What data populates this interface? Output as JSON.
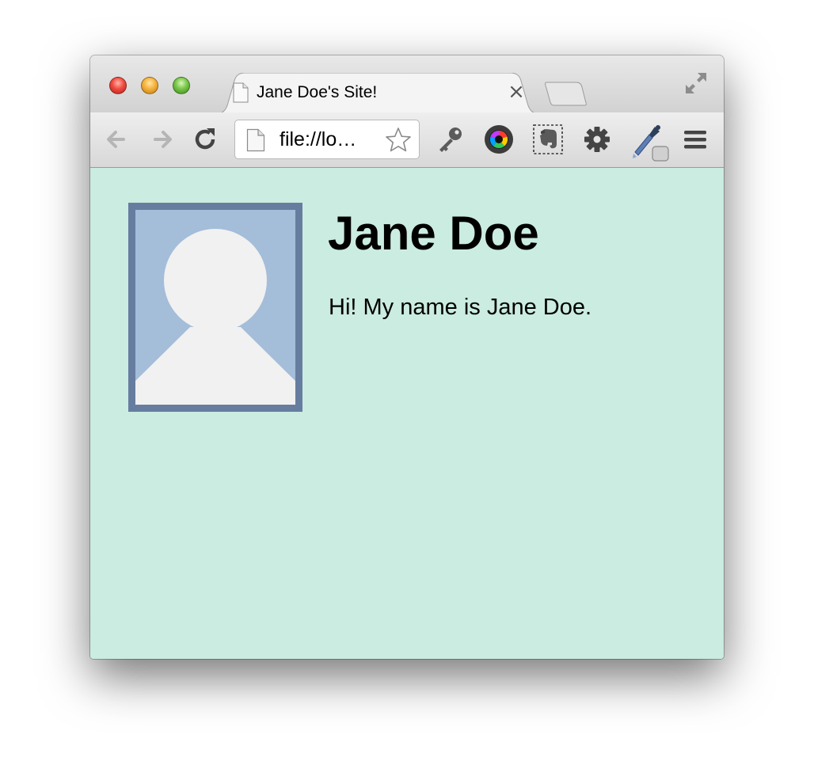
{
  "browser": {
    "tab": {
      "title": "Jane Doe's Site!",
      "close_glyph": "×",
      "favicon": "page-icon"
    },
    "toolbar": {
      "back_icon": "arrow-left-icon",
      "forward_icon": "arrow-right-icon",
      "reload_icon": "reload-icon",
      "address": "file://lo…",
      "bookmark_icon": "star-icon",
      "extensions": [
        "key-icon",
        "color-camera-icon",
        "evernote-elephant-icon",
        "gear-icon",
        "eyedropper-icon"
      ],
      "menu_icon": "hamburger-menu-icon"
    }
  },
  "page": {
    "background": "#cbece0",
    "heading": "Jane Doe",
    "intro": "Hi! My name is Jane Doe.",
    "avatar": {
      "frame_color": "#677da0",
      "fill_color": "#a4bdd9",
      "silhouette_color": "#f1f1f1"
    }
  }
}
